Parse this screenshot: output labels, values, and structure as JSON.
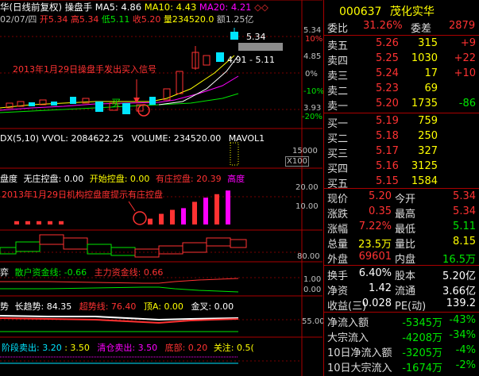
{
  "header": {
    "title_prefix": "华(日线前复权)",
    "indicator": "操盘手",
    "ma5": "MA5: 4.86",
    "ma10": "MA10: 4.43",
    "ma20": "MA20: 4.21",
    "date": "02/07/四",
    "open": "开5.34",
    "high": "高5.34",
    "low": "低5.11",
    "close": "收5.20",
    "volume": "量234520.0",
    "amount": "额1.25亿"
  },
  "price_axis": {
    "p1": "5.34",
    "pct1": "10%",
    "p2": "4.85",
    "pct2": "0%",
    "pct3": "-10%",
    "p3": "3.93",
    "pct4": "-20%"
  },
  "annotations": {
    "buy_signal": "2013年1月29日操盘手发出买入信号",
    "label_5_34": "5.34",
    "label_range": "4.91 - 5.11",
    "buy_char": "买",
    "control_signal": "2013年1月29日机构控盘度提示有庄控盘"
  },
  "vol_panel": {
    "title": "DX(5,10)",
    "vvol": "VVOL: 2084622.25",
    "volume": "VOLUME: 234520.00",
    "mavol": "MAVOL1",
    "axis": "15000",
    "mult": "X100"
  },
  "control_panel": {
    "title": "盘度",
    "no_control": "无庄控盘: 0.00",
    "start_control": "开始控盘: 0.00",
    "has_control": "有庄控盘: 20.39",
    "high_control": "高度",
    "axis1": "20.00",
    "axis2": "10.00",
    "bars": [
      0,
      2,
      2,
      2,
      2,
      2,
      0,
      0,
      0,
      0,
      0,
      0,
      0,
      3.5,
      6.4,
      8.8,
      9.8,
      13.6,
      16.1,
      18.2,
      20.39
    ]
  },
  "box_panel": {
    "axis": "80.00"
  },
  "fund_panel": {
    "title": "弈",
    "retail": "散户资金线: -0.66",
    "main": "主力资金线: 0.66",
    "axis1": "1.00",
    "axis2": "0.00"
  },
  "trend_panel": {
    "title": "势",
    "long_trend": "长趋势: 84.35",
    "super_trend": "超势线: 76.40",
    "top": "顶A: 0.00",
    "gold": "金叉: 0.00",
    "axis": "55.00"
  },
  "stage_panel": {
    "stage_sell": "阶段卖出: 3.20",
    "val2": ": 3.50",
    "clear_sell": "清仓卖出: 3.50",
    "bottom": "底部: 0.20",
    "attention": "关注: 0.5("
  },
  "quote": {
    "code": "000637",
    "name": "茂化实华",
    "weibi_label": "委比",
    "weibi": "31.26%",
    "weicha_label": "委差",
    "weicha": "2879",
    "sell": [
      {
        "label": "卖五",
        "price": "5.26",
        "vol": "315",
        "chg": "+9"
      },
      {
        "label": "卖四",
        "price": "5.25",
        "vol": "1030",
        "chg": "+22"
      },
      {
        "label": "卖三",
        "price": "5.24",
        "vol": "17",
        "chg": "+10"
      },
      {
        "label": "卖二",
        "price": "5.23",
        "vol": "69",
        "chg": ""
      },
      {
        "label": "卖一",
        "price": "5.20",
        "vol": "1735",
        "chg": "-86"
      }
    ],
    "buy": [
      {
        "label": "买一",
        "price": "5.19",
        "vol": "759"
      },
      {
        "label": "买二",
        "price": "5.18",
        "vol": "250"
      },
      {
        "label": "买三",
        "price": "5.17",
        "vol": "327"
      },
      {
        "label": "买四",
        "price": "5.16",
        "vol": "3125"
      },
      {
        "label": "买五",
        "price": "5.15",
        "vol": "1584"
      }
    ],
    "stats": [
      {
        "l1": "现价",
        "v1": "5.20",
        "l2": "今开",
        "v2": "5.34"
      },
      {
        "l1": "涨跌",
        "v1": "0.35",
        "l2": "最高",
        "v2": "5.34"
      },
      {
        "l1": "涨幅",
        "v1": "7.22%",
        "l2": "最低",
        "v2": "5.11"
      },
      {
        "l1": "总量",
        "v1": "23.5万",
        "l2": "量比",
        "v2": "8.15"
      },
      {
        "l1": "外盘",
        "v1": "69601",
        "l2": "内盘",
        "v2": "16.5万"
      }
    ],
    "stats2": [
      {
        "l1": "换手",
        "v1": "6.40%",
        "l2": "股本",
        "v2": "5.20亿"
      },
      {
        "l1": "净资",
        "v1": "1.42",
        "l2": "流通",
        "v2": "3.66亿"
      },
      {
        "l1": "收益(三)",
        "v1": "0.028",
        "l2": "PE(动)",
        "v2": "139.2"
      }
    ],
    "flows": [
      {
        "label": "净流入额",
        "value": "-5345万",
        "pct": "-43%"
      },
      {
        "label": "大宗流入",
        "value": "-4208万",
        "pct": "-34%"
      },
      {
        "label": "10日净流入额",
        "value": "-3205万",
        "pct": "-4%"
      },
      {
        "label": "10日大宗流入",
        "value": "-1674万",
        "pct": "-2%"
      }
    ]
  }
}
